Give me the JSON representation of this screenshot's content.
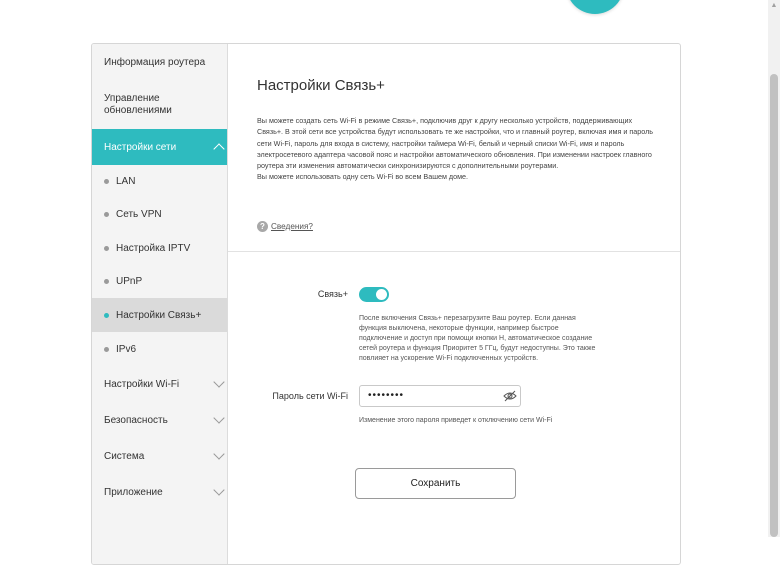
{
  "sidebar": {
    "items": [
      {
        "label": "Информация роутера"
      },
      {
        "label": "Управление обновлениями"
      },
      {
        "label": "Настройки сети"
      },
      {
        "label": "LAN"
      },
      {
        "label": "Сеть VPN"
      },
      {
        "label": "Настройка IPTV"
      },
      {
        "label": "UPnP"
      },
      {
        "label": "Настройки Связь+"
      },
      {
        "label": "IPv6"
      },
      {
        "label": "Настройки Wi-Fi"
      },
      {
        "label": "Безопасность"
      },
      {
        "label": "Система"
      },
      {
        "label": "Приложение"
      }
    ]
  },
  "main": {
    "title": "Настройки Связь+",
    "description": "Вы можете создать сеть Wi-Fi в режиме Связь+, подключив друг к другу несколько устройств, поддерживающих Связь+. В этой сети все устройства будут использовать те же настройки, что и главный роутер, включая имя и пароль сети Wi-Fi, пароль для входа в систему, настройки таймера Wi-Fi, белый и черный списки Wi-Fi, имя и пароль электросетевого адаптера часовой пояс и настройки автоматического обновления. При изменении настроек главного роутера эти изменения автоматически синхронизируются с дополнительными роутерами.",
    "description2": "Вы можете использовать одну сеть Wi-Fi во всем Вашем доме.",
    "info_link": "Сведения?",
    "svyaz_label": "Связь+",
    "toggle_on": true,
    "svyaz_note": "После включения Связь+ перезагрузите Ваш роутер. Если данная функция выключена, некоторые функции, например быстрое подключение и доступ при помощи кнопки H, автоматическое создание сетей роутера и функция Приоритет 5 ГГц, будут недоступны. Это также повлияет на ускорение Wi-Fi подключенных устройств.",
    "wifi_password_label": "Пароль сети Wi-Fi",
    "wifi_password_value": "••••••••",
    "password_note": "Изменение этого пароля приведет к отключению сети Wi-Fi",
    "save_label": "Сохранить"
  },
  "colors": {
    "accent": "#2ebbbf",
    "sidebar_bg": "#f4f4f4",
    "selected_bg": "#dadada"
  },
  "icons": [
    "question-icon",
    "eye-icon",
    "chevron-down-icon",
    "chevron-up-icon"
  ]
}
